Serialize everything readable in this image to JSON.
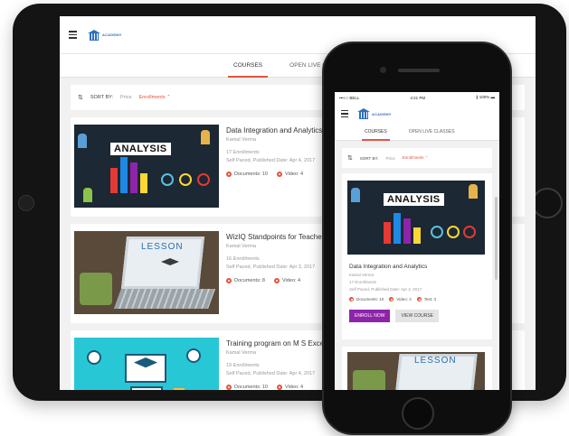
{
  "app": {
    "logo_text": "ACADEMY"
  },
  "tablet": {
    "tabs": [
      "COURSES",
      "OPEN LIVE C"
    ],
    "sort": {
      "label": "SORT BY:",
      "price": "Price",
      "enrollments": "Enrollments"
    },
    "courses": [
      {
        "title": "Data Integration and Analytics",
        "author": "Kamal Verma",
        "enrollments": "17 Enrollments",
        "published": "Self Paced, Published Date: Apr 4, 2017",
        "documents": "Documents: 10",
        "video": "Video: 4",
        "thumb_text": "ANALYSIS"
      },
      {
        "title": "WizIQ Standpoints for Teacher",
        "author": "Kamal Verma",
        "enrollments": "16 Enrollments",
        "published": "Self Paced, Published Date: Apr 3, 2017",
        "documents": "Documents: 8",
        "video": "Video: 4",
        "thumb_text": "LESSON"
      },
      {
        "title": "Training program on M S Exce",
        "author": "Kamal Verma",
        "enrollments": "19 Enrollments",
        "published": "Self Paced, Published Date: Apr 4, 2017",
        "documents": "Documents: 10",
        "video": "Video: 4",
        "thumb_text": ""
      }
    ]
  },
  "phone": {
    "status": {
      "carrier": "•••○○ BELL",
      "time": "4:21 PM",
      "battery": "100%"
    },
    "tabs": [
      "COURSES",
      "OPEN LIVE CLASSES"
    ],
    "sort": {
      "label": "SORT BY:",
      "price": "Price",
      "enrollments": "Enrollments"
    },
    "course": {
      "title": "Data Integration and Analytics",
      "author": "Kamal Verma",
      "enrollments": "17 Enrollments",
      "published": "Self Paced, Published Date: Apr 4, 2017",
      "documents": "Documents: 10",
      "video": "Video: 4",
      "test": "Test: 3",
      "thumb_text": "ANALYSIS",
      "enroll_label": "ENROLL NOW",
      "view_label": "VIEW COURSE"
    },
    "next_thumb_text": "LESSON"
  },
  "colors": {
    "accent": "#e5533d",
    "enroll_button": "#8e24aa",
    "logo": "#2c6fbf"
  }
}
